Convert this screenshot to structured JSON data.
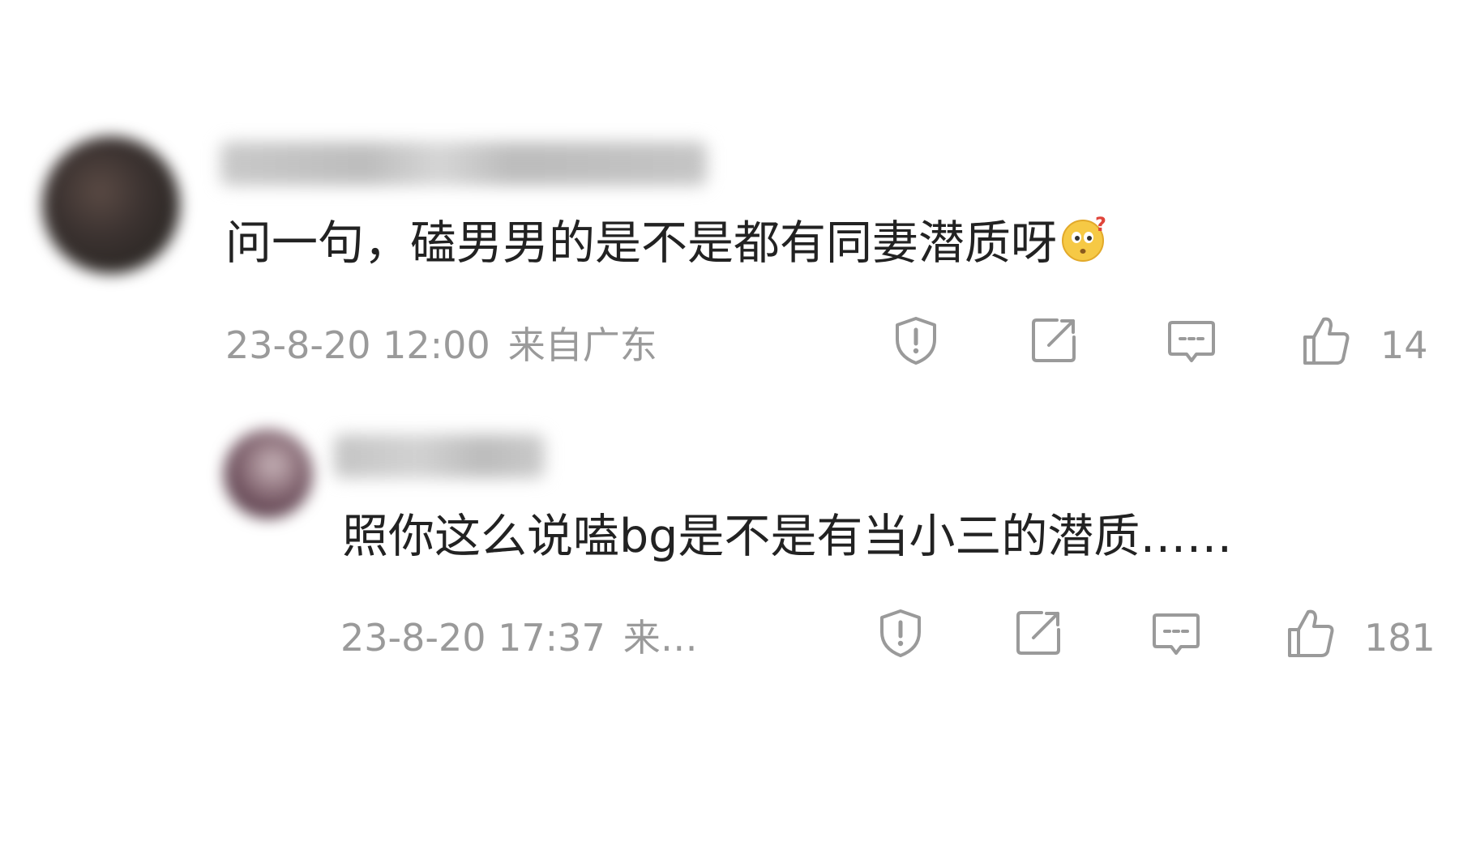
{
  "comments": [
    {
      "text": "问一句，磕男男的是不是都有同妻潜质呀",
      "emoji_icon": "thinking-face-question-emoji",
      "date": "23-8-20 12:00",
      "location": "来自广东",
      "likes": "14"
    },
    {
      "text": "照你这么说嗑bg是不是有当小三的潜质……",
      "date": "23-8-20 17:37",
      "location": "来…",
      "likes": "181"
    }
  ],
  "actions": [
    "report-shield-icon",
    "share-icon",
    "reply-comment-icon",
    "thumbs-up-icon"
  ],
  "colors": {
    "text": "#222222",
    "meta": "#9a9a9a",
    "icon": "#9a9a9a",
    "emoji_face": "#f6c945",
    "emoji_question": "#e0443a"
  }
}
